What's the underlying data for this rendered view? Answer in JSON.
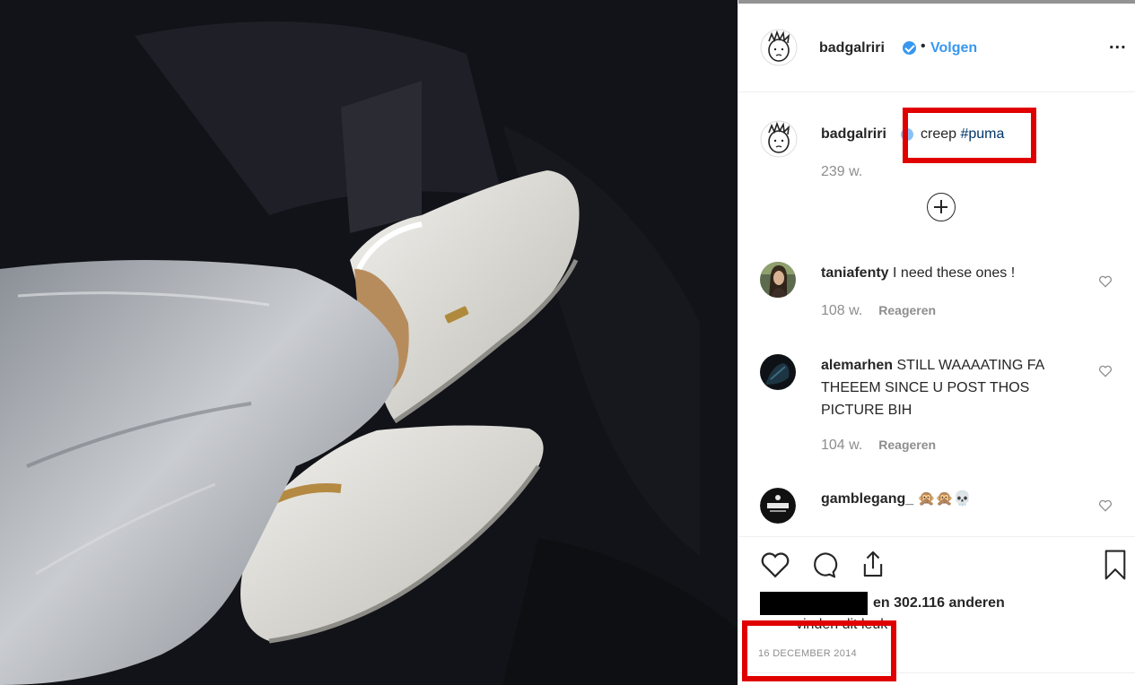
{
  "header": {
    "username": "badgalriri",
    "separator": "•",
    "follow_label": "Volgen",
    "more_label": "..."
  },
  "caption": {
    "username": "badgalriri",
    "text": "creep ",
    "hashtag": "#puma",
    "time": "239 w."
  },
  "comments": [
    {
      "username": "taniafenty",
      "text": "I need these ones !",
      "time": "108 w.",
      "reply_label": "Reageren"
    },
    {
      "username": "alemarhen",
      "text": "STILL WAAAATING FA THEEEM SINCE U POST THOS PICTURE BIH",
      "time": "104 w.",
      "reply_label": "Reageren"
    },
    {
      "username": "gamblegang_",
      "text": "🙊🙊💀"
    }
  ],
  "likes": {
    "text": "en 302.116 anderen",
    "liked_by": "vinden dit leuk"
  },
  "post_date": "16 DECEMBER 2014",
  "colors": {
    "accent": "#3897f0",
    "highlight": "#e00000"
  },
  "icons": [
    "verified-badge-icon",
    "more-options-icon",
    "load-more-icon",
    "heart-icon",
    "comment-icon",
    "share-icon",
    "bookmark-icon"
  ]
}
